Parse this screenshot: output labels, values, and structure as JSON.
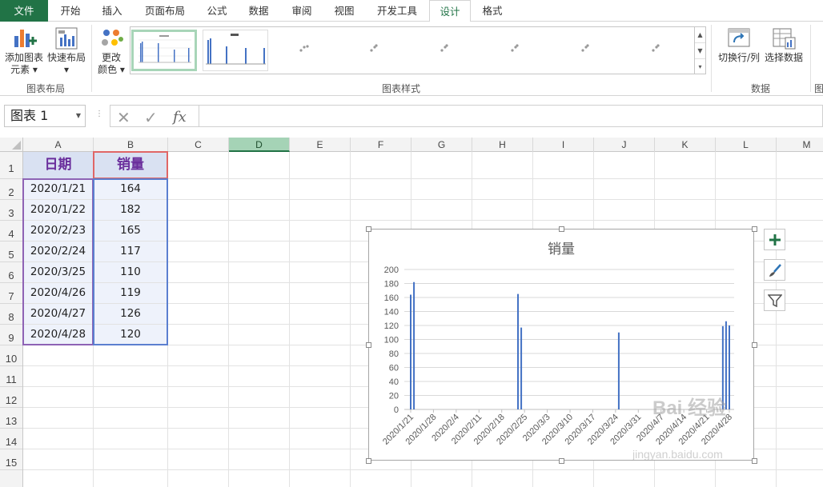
{
  "tabs": [
    "文件",
    "开始",
    "插入",
    "页面布局",
    "公式",
    "数据",
    "审阅",
    "视图",
    "开发工具",
    "设计",
    "格式"
  ],
  "ribbon": {
    "add_element": "添加图表",
    "add_element2": "元素",
    "quick_layout": "快速布局",
    "change_color": "更改",
    "change_color2": "颜色",
    "group_layout": "图表布局",
    "group_styles": "图表样式",
    "switch_row_col": "切换行/列",
    "select_data": "选择数据",
    "group_data": "数据",
    "group_cut": "图"
  },
  "formula_bar": {
    "name_box": "图表 1",
    "fx": "fx",
    "value": ""
  },
  "columns": [
    "A",
    "B",
    "C",
    "D",
    "E",
    "F",
    "G",
    "H",
    "I",
    "J",
    "K",
    "L",
    "M"
  ],
  "rows": [
    "1",
    "2",
    "3",
    "4",
    "5",
    "6",
    "7",
    "8",
    "9",
    "10",
    "11",
    "12",
    "13",
    "14",
    "15"
  ],
  "table": {
    "header_date": "日期",
    "header_sales": "销量",
    "rows": [
      {
        "date": "2020/1/21",
        "sales": "164"
      },
      {
        "date": "2020/1/22",
        "sales": "182"
      },
      {
        "date": "2020/2/23",
        "sales": "165"
      },
      {
        "date": "2020/2/24",
        "sales": "117"
      },
      {
        "date": "2020/3/25",
        "sales": "110"
      },
      {
        "date": "2020/4/26",
        "sales": "119"
      },
      {
        "date": "2020/4/27",
        "sales": "126"
      },
      {
        "date": "2020/4/28",
        "sales": "120"
      }
    ]
  },
  "chart_data": {
    "type": "bar",
    "title": "销量",
    "x": [
      "2020-01-21",
      "2020-01-22",
      "2020-02-23",
      "2020-02-24",
      "2020-03-25",
      "2020-04-26",
      "2020-04-27",
      "2020-04-28"
    ],
    "values": [
      164,
      182,
      165,
      117,
      110,
      119,
      126,
      120
    ],
    "xlabel": "",
    "ylabel": "",
    "ylim": [
      0,
      200
    ],
    "yticks": [
      0,
      20,
      40,
      60,
      80,
      100,
      120,
      140,
      160,
      180,
      200
    ],
    "xticks": [
      "2020/1/21",
      "2020/1/28",
      "2020/2/4",
      "2020/2/11",
      "2020/2/18",
      "2020/2/25",
      "2020/3/3",
      "2020/3/10",
      "2020/3/17",
      "2020/3/24",
      "2020/3/31",
      "2020/4/7",
      "2020/4/14",
      "2020/4/21",
      "2020/4/28"
    ],
    "xtick_days": [
      0,
      7,
      14,
      21,
      28,
      35,
      42,
      49,
      56,
      63,
      70,
      77,
      84,
      91,
      98
    ],
    "grid": true,
    "legend": "none",
    "bar_color": "#4472c4"
  },
  "watermark": "Bai 经验",
  "watermark_url": "jingyan.baidu.com",
  "colors": {
    "accent": "#217346",
    "header_fill": "#d9e1f2",
    "header_text": "#6a2e9c"
  }
}
